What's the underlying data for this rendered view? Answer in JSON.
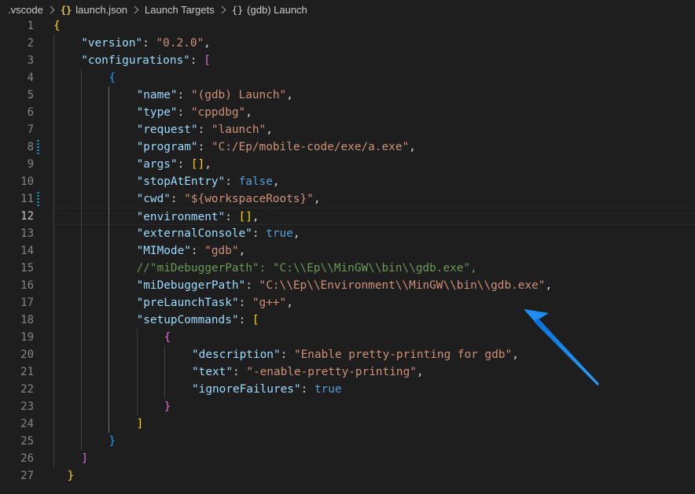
{
  "breadcrumb": {
    "items": [
      {
        "label": ".vscode",
        "icon": ""
      },
      {
        "label": "launch.json",
        "icon": "{}"
      },
      {
        "label": "Launch Targets",
        "icon": ""
      },
      {
        "label": "(gdb) Launch",
        "icon": "{}"
      }
    ]
  },
  "editor": {
    "current_line": 12,
    "modified_lines": [
      8,
      11
    ],
    "lines": [
      {
        "n": "1",
        "indent": 0,
        "tokens": [
          [
            "br1",
            "{"
          ]
        ]
      },
      {
        "n": "2",
        "indent": 1,
        "tokens": [
          [
            "k",
            "\"version\""
          ],
          [
            "p",
            ": "
          ],
          [
            "s",
            "\"0.2.0\""
          ],
          [
            "p",
            ","
          ]
        ]
      },
      {
        "n": "3",
        "indent": 1,
        "tokens": [
          [
            "k",
            "\"configurations\""
          ],
          [
            "p",
            ": "
          ],
          [
            "br2",
            "["
          ]
        ]
      },
      {
        "n": "4",
        "indent": 2,
        "tokens": [
          [
            "br3",
            "{"
          ]
        ]
      },
      {
        "n": "5",
        "indent": 3,
        "tokens": [
          [
            "k",
            "\"name\""
          ],
          [
            "p",
            ": "
          ],
          [
            "s",
            "\"(gdb) Launch\""
          ],
          [
            "p",
            ","
          ]
        ]
      },
      {
        "n": "6",
        "indent": 3,
        "tokens": [
          [
            "k",
            "\"type\""
          ],
          [
            "p",
            ": "
          ],
          [
            "s",
            "\"cppdbg\""
          ],
          [
            "p",
            ","
          ]
        ]
      },
      {
        "n": "7",
        "indent": 3,
        "tokens": [
          [
            "k",
            "\"request\""
          ],
          [
            "p",
            ": "
          ],
          [
            "s",
            "\"launch\""
          ],
          [
            "p",
            ","
          ]
        ]
      },
      {
        "n": "8",
        "indent": 3,
        "tokens": [
          [
            "k",
            "\"program\""
          ],
          [
            "p",
            ": "
          ],
          [
            "s",
            "\"C:/Ep/mobile-code/exe/a.exe\""
          ],
          [
            "p",
            ","
          ]
        ]
      },
      {
        "n": "9",
        "indent": 3,
        "tokens": [
          [
            "k",
            "\"args\""
          ],
          [
            "p",
            ": "
          ],
          [
            "br1",
            "[]"
          ],
          [
            "p",
            ","
          ]
        ]
      },
      {
        "n": "10",
        "indent": 3,
        "tokens": [
          [
            "k",
            "\"stopAtEntry\""
          ],
          [
            "p",
            ": "
          ],
          [
            "b",
            "false"
          ],
          [
            "p",
            ","
          ]
        ]
      },
      {
        "n": "11",
        "indent": 3,
        "tokens": [
          [
            "k",
            "\"cwd\""
          ],
          [
            "p",
            ": "
          ],
          [
            "s",
            "\"${workspaceRoots}\""
          ],
          [
            "p",
            ","
          ]
        ]
      },
      {
        "n": "12",
        "indent": 3,
        "tokens": [
          [
            "k",
            "\"environment\""
          ],
          [
            "p",
            ": "
          ],
          [
            "br1",
            "[]"
          ],
          [
            "p",
            ","
          ]
        ]
      },
      {
        "n": "13",
        "indent": 3,
        "tokens": [
          [
            "k",
            "\"externalConsole\""
          ],
          [
            "p",
            ": "
          ],
          [
            "b",
            "true"
          ],
          [
            "p",
            ","
          ]
        ]
      },
      {
        "n": "14",
        "indent": 3,
        "tokens": [
          [
            "k",
            "\"MIMode\""
          ],
          [
            "p",
            ": "
          ],
          [
            "s",
            "\"gdb\""
          ],
          [
            "p",
            ","
          ]
        ]
      },
      {
        "n": "15",
        "indent": 3,
        "tokens": [
          [
            "c",
            "//\"miDebuggerPath\": \"C:\\\\Ep\\\\MinGW\\\\bin\\\\gdb.exe\","
          ]
        ]
      },
      {
        "n": "16",
        "indent": 3,
        "tokens": [
          [
            "k",
            "\"miDebuggerPath\""
          ],
          [
            "p",
            ": "
          ],
          [
            "s",
            "\"C:\\\\Ep\\\\Environment\\\\MinGW\\\\bin\\\\gdb.exe\""
          ],
          [
            "p",
            ","
          ]
        ]
      },
      {
        "n": "17",
        "indent": 3,
        "tokens": [
          [
            "k",
            "\"preLaunchTask\""
          ],
          [
            "p",
            ": "
          ],
          [
            "s",
            "\"g++\""
          ],
          [
            "p",
            ","
          ]
        ]
      },
      {
        "n": "18",
        "indent": 3,
        "tokens": [
          [
            "k",
            "\"setupCommands\""
          ],
          [
            "p",
            ": "
          ],
          [
            "br1",
            "["
          ]
        ]
      },
      {
        "n": "19",
        "indent": 4,
        "tokens": [
          [
            "br2",
            "{"
          ]
        ]
      },
      {
        "n": "20",
        "indent": 5,
        "tokens": [
          [
            "k",
            "\"description\""
          ],
          [
            "p",
            ": "
          ],
          [
            "s",
            "\"Enable pretty-printing for gdb\""
          ],
          [
            "p",
            ","
          ]
        ]
      },
      {
        "n": "21",
        "indent": 5,
        "tokens": [
          [
            "k",
            "\"text\""
          ],
          [
            "p",
            ": "
          ],
          [
            "s",
            "\"-enable-pretty-printing\""
          ],
          [
            "p",
            ","
          ]
        ]
      },
      {
        "n": "22",
        "indent": 5,
        "tokens": [
          [
            "k",
            "\"ignoreFailures\""
          ],
          [
            "p",
            ": "
          ],
          [
            "b",
            "true"
          ]
        ]
      },
      {
        "n": "23",
        "indent": 4,
        "tokens": [
          [
            "br2",
            "}"
          ]
        ]
      },
      {
        "n": "24",
        "indent": 3,
        "tokens": [
          [
            "br1",
            "]"
          ]
        ]
      },
      {
        "n": "25",
        "indent": 2,
        "tokens": [
          [
            "br3",
            "}"
          ]
        ]
      },
      {
        "n": "26",
        "indent": 1,
        "tokens": [
          [
            "br2",
            "]"
          ]
        ]
      },
      {
        "n": "27",
        "indent": 0.5,
        "tokens": [
          [
            "br1",
            "}"
          ]
        ]
      }
    ]
  },
  "annotation": {
    "arrow_color": "#1e90f5",
    "points_to_line": 16
  }
}
